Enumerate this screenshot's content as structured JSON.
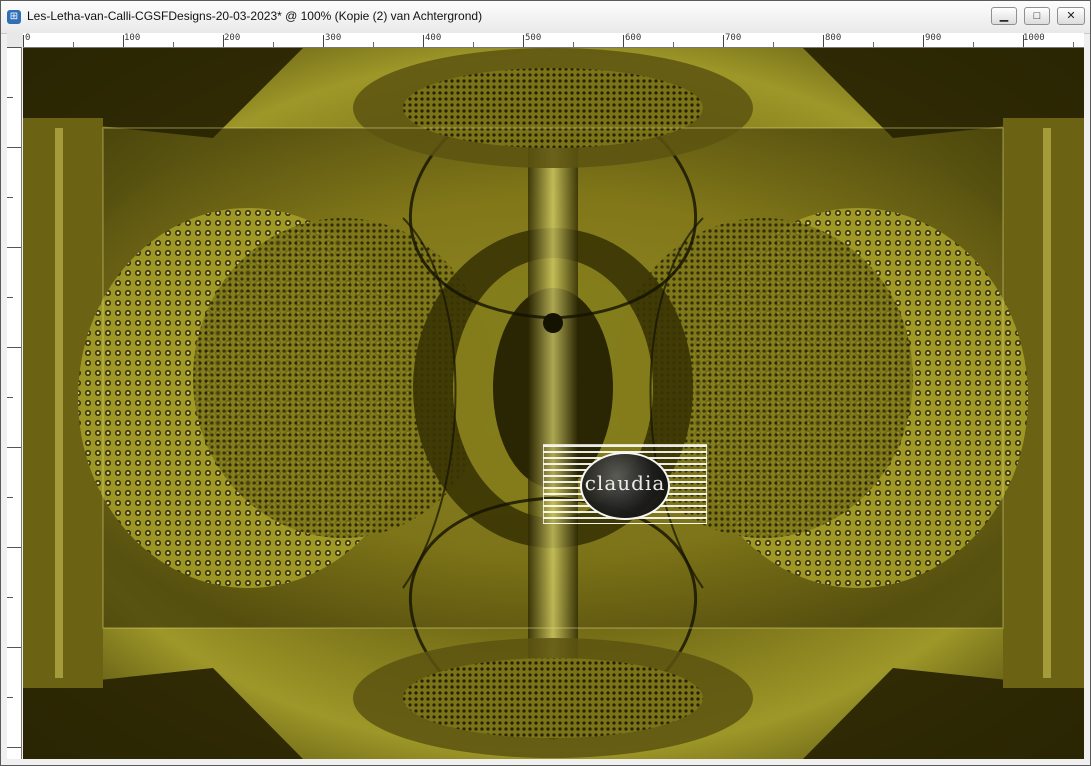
{
  "window": {
    "title": "Les-Letha-van-Calli-CGSFDesigns-20-03-2023* @ 100% (Kopie (2) van Achtergrond)",
    "app_icon": "app-icon",
    "buttons": {
      "minimize": "minimize-icon",
      "maximize": "maximize-icon",
      "close": "close-icon"
    }
  },
  "ruler": {
    "labels": [
      "0",
      "100",
      "200",
      "300",
      "400",
      "500",
      "600",
      "700",
      "800",
      "900",
      "1000"
    ]
  },
  "canvas": {
    "watermark": "claudia",
    "colors": {
      "dark": "#2b2603",
      "mid": "#6a6212",
      "bright": "#b9b23a",
      "highlight": "#e7e38a"
    }
  }
}
